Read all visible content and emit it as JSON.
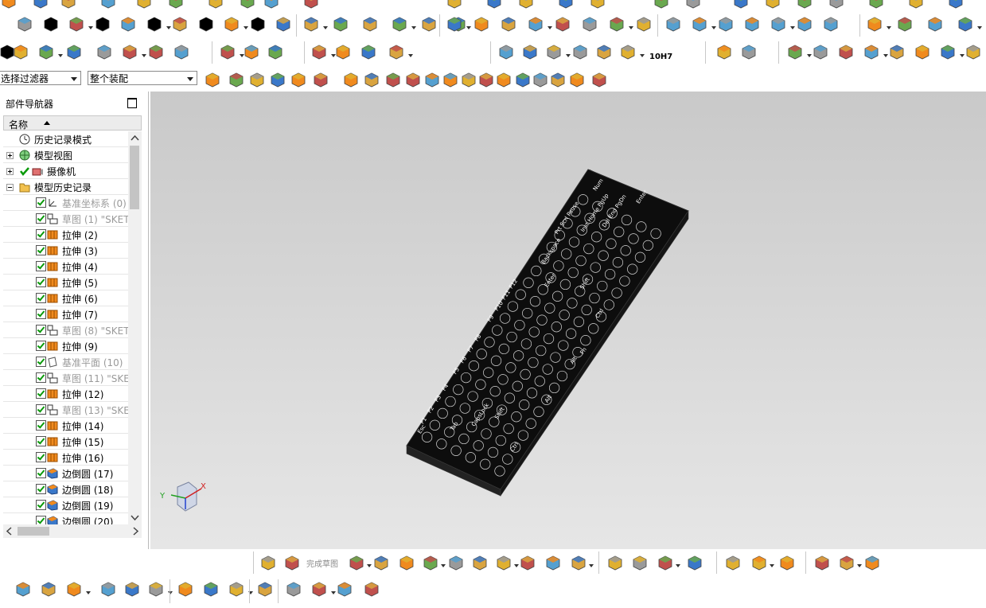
{
  "filters": {
    "selection_filter": "选择过滤器",
    "assembly_scope": "整个装配"
  },
  "navigator": {
    "title": "部件导航器",
    "column_name": "名称",
    "items": [
      {
        "label": "历史记录模式",
        "kind": "clock",
        "grey": false
      },
      {
        "label": "模型视图",
        "kind": "views",
        "grey": false
      },
      {
        "label": "摄像机",
        "kind": "camera",
        "grey": false
      },
      {
        "label": "模型历史记录",
        "kind": "folder",
        "grey": false
      },
      {
        "label": "基准坐标系 (0)",
        "kind": "csys",
        "grey": true
      },
      {
        "label": "草图 (1) \"SKET",
        "kind": "sketch",
        "grey": true
      },
      {
        "label": "拉伸 (2)",
        "kind": "extrude",
        "grey": false
      },
      {
        "label": "拉伸 (3)",
        "kind": "extrude",
        "grey": false
      },
      {
        "label": "拉伸 (4)",
        "kind": "extrude",
        "grey": false
      },
      {
        "label": "拉伸 (5)",
        "kind": "extrude",
        "grey": false
      },
      {
        "label": "拉伸 (6)",
        "kind": "extrude",
        "grey": false
      },
      {
        "label": "拉伸 (7)",
        "kind": "extrude",
        "grey": false
      },
      {
        "label": "草图 (8) \"SKET",
        "kind": "sketch",
        "grey": true
      },
      {
        "label": "拉伸 (9)",
        "kind": "extrude",
        "grey": false
      },
      {
        "label": "基准平面 (10)",
        "kind": "plane",
        "grey": true
      },
      {
        "label": "草图 (11) \"SKE",
        "kind": "sketch",
        "grey": true
      },
      {
        "label": "拉伸 (12)",
        "kind": "extrude",
        "grey": false
      },
      {
        "label": "草图 (13) \"SKE",
        "kind": "sketch",
        "grey": true
      },
      {
        "label": "拉伸 (14)",
        "kind": "extrude",
        "grey": false
      },
      {
        "label": "拉伸 (15)",
        "kind": "extrude",
        "grey": false
      },
      {
        "label": "拉伸 (16)",
        "kind": "extrude",
        "grey": false
      },
      {
        "label": "边倒圆 (17)",
        "kind": "blend",
        "grey": false
      },
      {
        "label": "边倒圆 (18)",
        "kind": "blend",
        "grey": false
      },
      {
        "label": "边倒圆 (19)",
        "kind": "blend",
        "grey": false
      },
      {
        "label": "边倒圆 (20)",
        "kind": "blend",
        "grey": false
      }
    ]
  },
  "toolbar": {
    "finish_sketch": "完成草图",
    "tolerance_label": "10H7"
  },
  "triad": {
    "x": "X",
    "y": "Y"
  },
  "keyboard": {
    "key_labels": [
      "Esc",
      "Tab",
      "CapsLock",
      "Shift",
      "Ctrl",
      "Alt",
      "Enter",
      "Backspace",
      "Shift",
      "Ctrl",
      "Alt",
      "Fn",
      "Prt Scrl Pause",
      "Inst Home PgUp",
      "Del End PgDn",
      "Num",
      "Enter",
      "F1",
      "F2",
      "F3",
      "F4",
      "F5",
      "F6",
      "F7",
      "F8",
      "F9",
      "F10",
      "F11",
      "F12"
    ]
  },
  "colors": {
    "accent_orange": "#e8922a",
    "accent_blue": "#3a78c9",
    "check_green": "#0a9a0a",
    "viewport_top": "#c9c9c9",
    "viewport_bottom": "#e6e6e6",
    "model_black": "#0d0d0d"
  }
}
